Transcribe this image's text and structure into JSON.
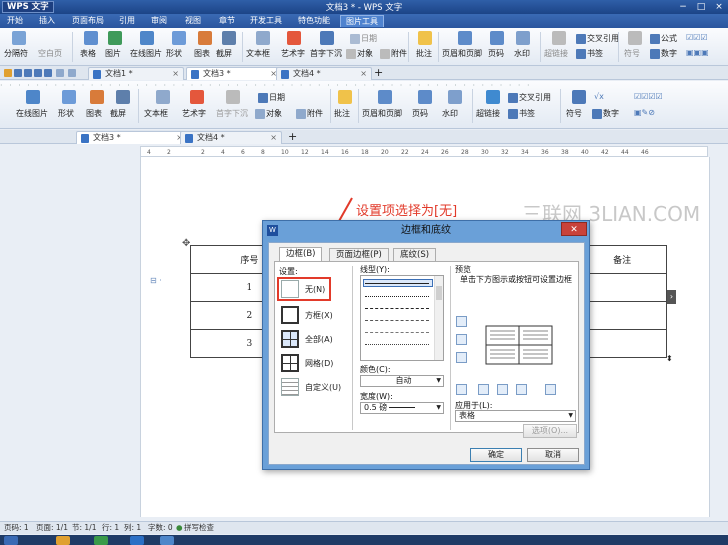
{
  "titlebar": {
    "app_name": "WPS 文字",
    "title": "文档3 * - WPS 文字",
    "minimize": "−",
    "maximize": "□",
    "close": "×"
  },
  "menu_tabs": [
    "开始",
    "插入",
    "页面布局",
    "引用",
    "审阅",
    "视图",
    "章节",
    "开发工具",
    "特色功能",
    "图片工具"
  ],
  "ribbon1": {
    "items": [
      "分隔符",
      "空白页",
      "表格",
      "图片",
      "在线图片",
      "形状",
      "图表",
      "截屏",
      "文本框",
      "艺术字",
      "首字下沉",
      "日期",
      "对象",
      "附件",
      "批注",
      "页眉和页脚",
      "页码",
      "水印",
      "超链接",
      "书签",
      "交叉引用",
      "符号",
      "公式",
      "数字"
    ]
  },
  "doc_tabs_1": [
    "文档1 *",
    "文档3 *",
    "文档4 *"
  ],
  "ribbon2": {
    "items": [
      "在线图片",
      "形状",
      "图表",
      "截屏",
      "文本框",
      "艺术字",
      "首字下沉",
      "日期",
      "对象",
      "附件",
      "批注",
      "页眉和页脚",
      "页码",
      "水印",
      "超链接",
      "书签",
      "交叉引用",
      "符号",
      "数字"
    ]
  },
  "doc_tabs_2": [
    "文档3 *",
    "文档4 *"
  ],
  "ruler_ticks": [
    "4",
    "2",
    "2",
    "4",
    "6",
    "8",
    "10",
    "12",
    "14",
    "16",
    "18",
    "20",
    "22",
    "24",
    "26",
    "28",
    "30",
    "32",
    "34",
    "36",
    "38",
    "40",
    "42",
    "44",
    "46"
  ],
  "table": {
    "header": [
      "序号",
      "",
      "",
      "",
      "备注"
    ],
    "rows": [
      [
        "1",
        "",
        "",
        "",
        ""
      ],
      [
        "2",
        "",
        "",
        "",
        ""
      ],
      [
        "3",
        "",
        "",
        "",
        ""
      ]
    ]
  },
  "annotation": "设置项选择为[无]",
  "watermark": "三联网 3LIAN.COM",
  "dialog": {
    "title": "边框和底纹",
    "app_icon": "W",
    "close": "✕",
    "tabs": [
      "边框(B)",
      "页面边框(P)",
      "底纹(S)"
    ],
    "settings_label": "设置:",
    "settings": [
      "无(N)",
      "方框(X)",
      "全部(A)",
      "网格(D)",
      "自定义(U)"
    ],
    "line_style_label": "线型(Y):",
    "color_label": "颜色(C):",
    "color_value": "自动",
    "width_label": "宽度(W):",
    "width_value": "0.5  磅",
    "preview_label": "预览",
    "preview_hint": "单击下方图示或按钮可设置边框",
    "apply_label": "应用于(L):",
    "apply_value": "表格",
    "options_button": "选项(O)...",
    "ok_button": "确定",
    "cancel_button": "取消"
  },
  "statusbar": {
    "page": "页码: 1",
    "pages": "页面: 1/1",
    "section": "节: 1/1",
    "row": "行: 1",
    "col": "列: 1",
    "words": "字数: 0",
    "spell": "拼写检查"
  },
  "colors": {
    "accent": "#2a559e",
    "annotation": "#e23a2a",
    "dialog_frame": "#6aa0d8"
  }
}
